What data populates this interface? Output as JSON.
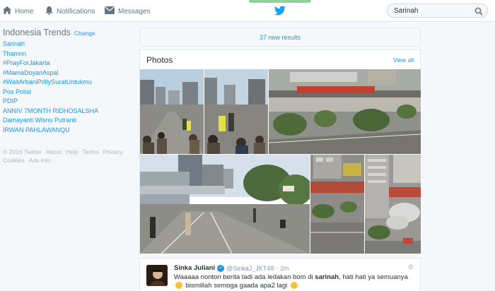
{
  "nav": {
    "home_label": "Home",
    "notifications_label": "Notifications",
    "messages_label": "Messages"
  },
  "search": {
    "value": "Sarinah"
  },
  "trends": {
    "title": "Indonesia Trends",
    "change_label": "Change",
    "items": [
      "Sarinah",
      "Thamrin",
      "#PrayForJakarta",
      "#MamaDoyanAspal",
      "#WaitArbaniPrillySuratUntukmu",
      "Pos Polisi",
      "PDIP",
      "ANNIV 7MONTH RIDHOSALSHA",
      "Damayanti Wisnu Putranti",
      "IRWAN PAHLAWANQU"
    ]
  },
  "footer": {
    "links": [
      "© 2016 Twitter",
      "About",
      "Help",
      "Terms",
      "Privacy",
      "Cookies",
      "Ads info"
    ]
  },
  "main": {
    "new_results": "37 new results",
    "photos_title": "Photos",
    "view_all": "View all"
  },
  "tweet": {
    "name": "Sinka Juliani",
    "handle": "@SinkaJ_JKT48",
    "time": "2m",
    "text_before": "Waaaaa nonton berita tadi ada ledakan bom di ",
    "text_bold": "sarinah",
    "text_after": ", hati hati ya semuanya",
    "text_line2": "bismillah semoga gaada apa2 lagi"
  },
  "colors": {
    "link": "#1b95e0",
    "muted": "#66757f",
    "progress": "#8fd19e"
  }
}
